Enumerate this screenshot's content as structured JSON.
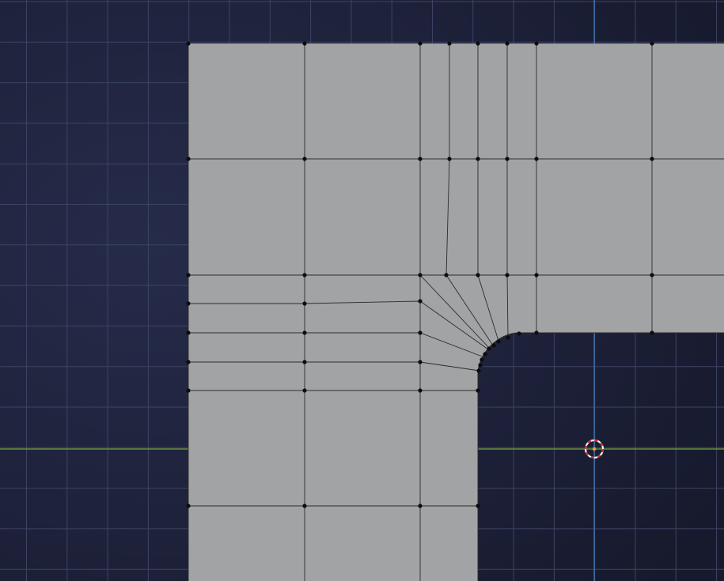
{
  "viewport": {
    "view_mode": "top-orthographic",
    "edit_mode": "edit-mode-vertex",
    "colors": {
      "background_center": "#262b4a",
      "background_edge": "#171a2d",
      "grid_line": "#3d4463",
      "mesh_face": "#a2a3a5",
      "mesh_edge": "#2c2c2c",
      "vertex": "#0d0d0d",
      "x_axis": "#7aa23a",
      "y_axis": "#3f7cc4",
      "cursor_ring_red": "#d03030",
      "cursor_ring_white": "#f2f2f2",
      "cursor_center": "#e8a23a"
    },
    "icons": {
      "cursor": "3d-cursor-icon"
    }
  }
}
